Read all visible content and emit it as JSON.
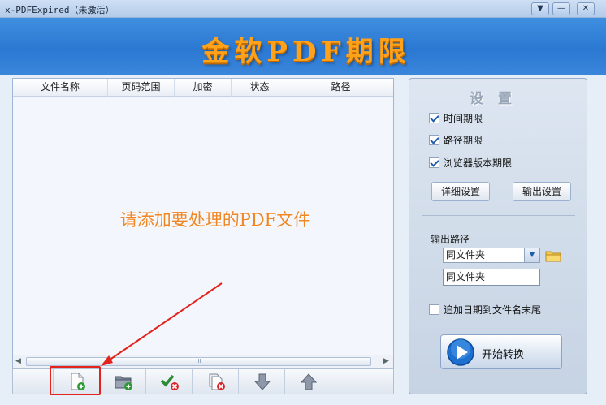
{
  "window": {
    "title": "x-PDFExpired（未激活）",
    "btn_menu": "▼",
    "btn_minimize": "—",
    "btn_close": "✕"
  },
  "banner": {
    "brand": "金软PDF期限"
  },
  "file_list": {
    "columns": [
      "文件名称",
      "页码范围",
      "加密",
      "状态",
      "路径"
    ],
    "empty_hint": "请添加要处理的PDF文件",
    "scroll_grip": "III"
  },
  "toolbar": {
    "buttons": [
      {
        "icon": "add-file-icon"
      },
      {
        "icon": "add-folder-icon"
      },
      {
        "icon": "check-remove-icon"
      },
      {
        "icon": "remove-all-icon"
      },
      {
        "icon": "move-down-icon"
      },
      {
        "icon": "move-up-icon"
      }
    ]
  },
  "settings": {
    "title": "设置",
    "options": [
      {
        "label": "时间期限",
        "checked": true
      },
      {
        "label": "路径期限",
        "checked": true
      },
      {
        "label": "浏览器版本期限",
        "checked": true
      }
    ],
    "detail_button": "详细设置",
    "output_button": "输出设置",
    "output_path_label": "输出路径",
    "output_path_select": "同文件夹",
    "output_path_value": "同文件夹",
    "append_date": {
      "label": "追加日期到文件名末尾",
      "checked": false
    },
    "start_button": "开始转换"
  },
  "colors": {
    "accent_orange": "#ffa21a",
    "hint_orange": "#f08624",
    "highlight_red": "#e3231b",
    "banner_blue": "#2b78d2"
  }
}
